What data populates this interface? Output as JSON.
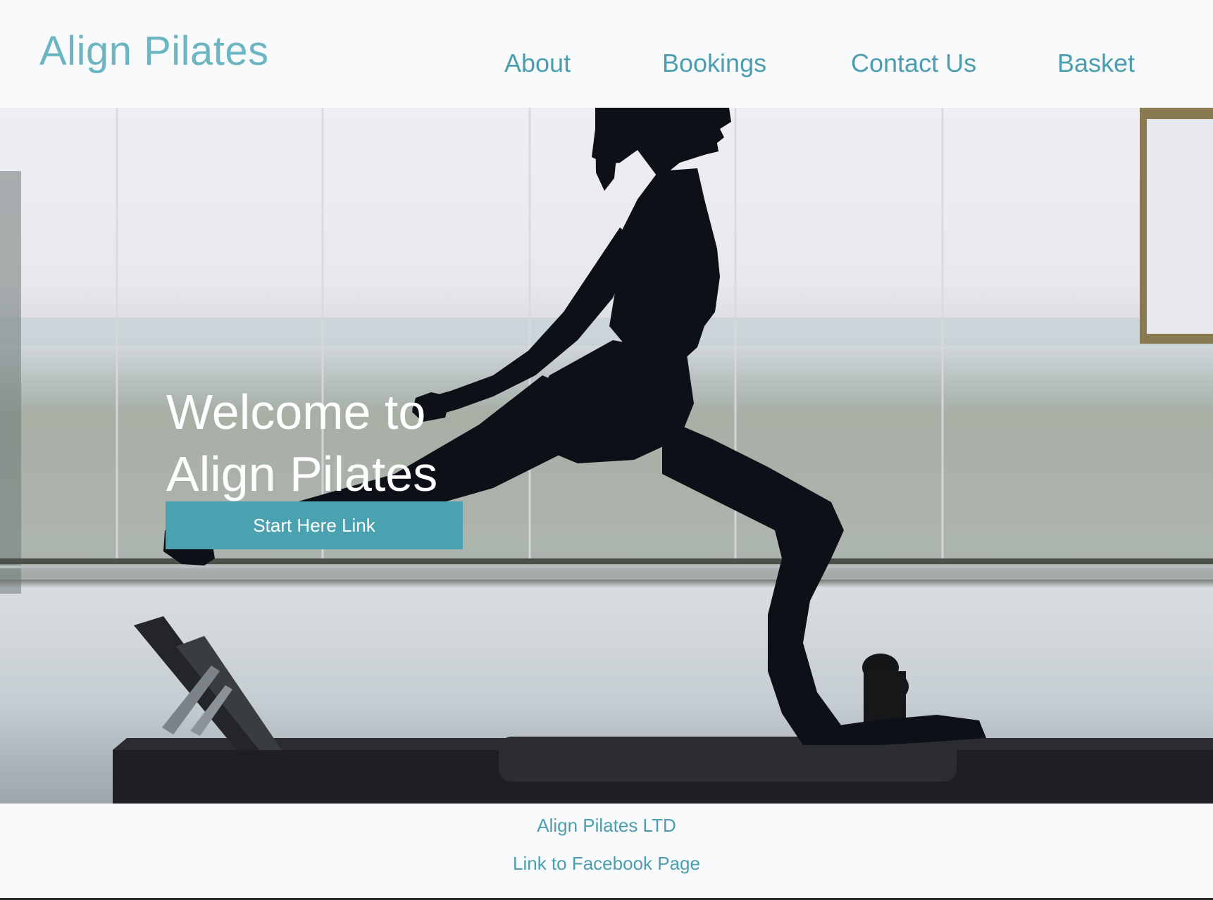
{
  "header": {
    "brand": "Align Pilates",
    "nav": {
      "about": "About",
      "bookings": "Bookings",
      "contact": "Contact Us",
      "basket": "Basket"
    }
  },
  "hero": {
    "title_line1": "Welcome to",
    "title_line2": "Align Pilates",
    "cta_label": "Start Here Link",
    "image_subject": "silhouette of woman doing lunge on pilates reformer"
  },
  "footer": {
    "company": "Align Pilates LTD",
    "facebook_link": "Link to Facebook Page"
  },
  "colors": {
    "brand_teal": "#6cb6c3",
    "nav_teal": "#4b9eaf",
    "cta_bg": "#4aa2b1",
    "page_bg": "#f9fafb"
  }
}
